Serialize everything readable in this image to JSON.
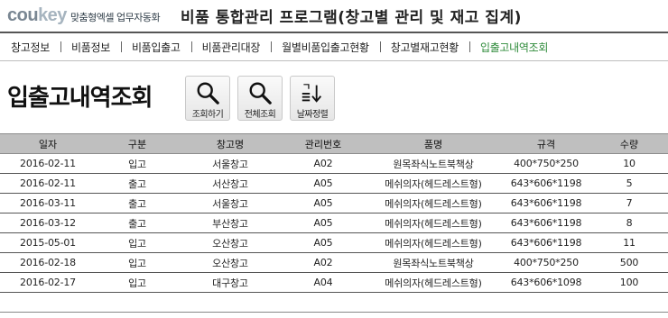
{
  "header": {
    "logo_brand_a": "cou",
    "logo_brand_b": "key",
    "logo_sub": "맞춤형엑셀 업무자동화",
    "title": "비품 통합관리 프로그램(창고별 관리 및 재고 집계)"
  },
  "nav": {
    "items": [
      {
        "label": "창고정보"
      },
      {
        "label": "비품정보"
      },
      {
        "label": "비품입출고"
      },
      {
        "label": "비품관리대장"
      },
      {
        "label": "월별비품입출고현황"
      },
      {
        "label": "창고별재고현황"
      },
      {
        "label": "입출고내역조회"
      }
    ]
  },
  "page": {
    "title": "입출고내역조회"
  },
  "toolbar": {
    "search_label": "조회하기",
    "search_all_label": "전체조회",
    "sort_label": "날짜정렬",
    "sort_glyph": "ㄱ"
  },
  "table": {
    "headers": [
      "일자",
      "구분",
      "창고명",
      "관리번호",
      "품명",
      "규격",
      "수량"
    ],
    "rows": [
      [
        "2016-02-11",
        "입고",
        "서울창고",
        "A02",
        "원목좌식노트북책상",
        "400*750*250",
        "10"
      ],
      [
        "2016-02-11",
        "출고",
        "서산창고",
        "A05",
        "메쉬의자(헤드레스트형)",
        "643*606*1198",
        "5"
      ],
      [
        "2016-03-11",
        "출고",
        "서울창고",
        "A05",
        "메쉬의자(헤드레스트형)",
        "643*606*1198",
        "7"
      ],
      [
        "2016-03-12",
        "출고",
        "부산창고",
        "A05",
        "메쉬의자(헤드레스트형)",
        "643*606*1198",
        "8"
      ],
      [
        "2015-05-01",
        "입고",
        "오산창고",
        "A05",
        "메쉬의자(헤드레스트형)",
        "643*606*1198",
        "11"
      ],
      [
        "2016-02-18",
        "입고",
        "오산창고",
        "A02",
        "원목좌식노트북책상",
        "400*750*250",
        "500"
      ],
      [
        "2016-02-17",
        "입고",
        "대구창고",
        "A04",
        "메쉬의자(헤드레스트형)",
        "643*606*1098",
        "100"
      ]
    ]
  },
  "colors": {
    "active_nav": "#2e8b3a",
    "table_header_bg": "#bfbfbf"
  },
  "icons": {
    "search": "search-icon",
    "search_all": "search-icon",
    "sort": "sort-ascending-icon"
  }
}
